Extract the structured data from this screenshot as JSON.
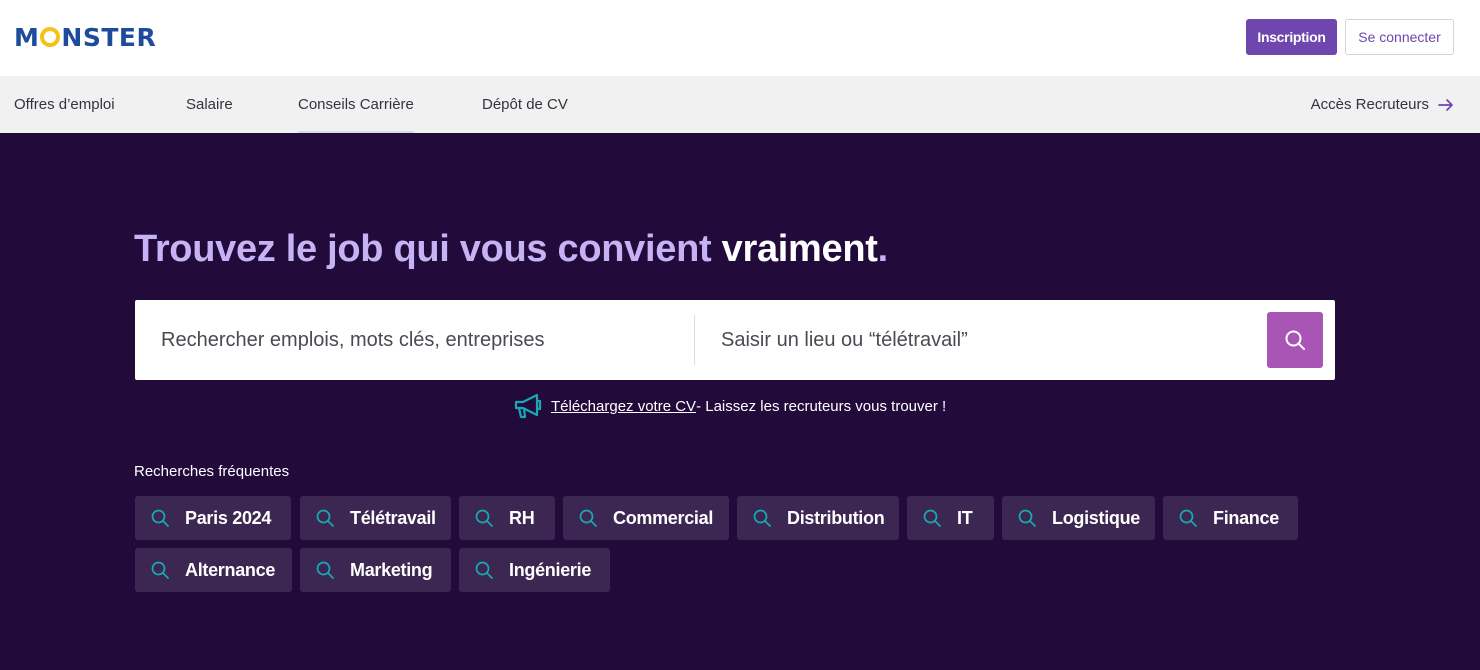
{
  "header": {
    "logo_before": "M",
    "logo_after": "NSTER",
    "signup_label": "Inscription",
    "login_label": "Se connecter"
  },
  "nav": {
    "items": [
      {
        "label": "Offres d’emploi"
      },
      {
        "label": "Salaire"
      },
      {
        "label": "Conseils Carrière"
      },
      {
        "label": "Dépôt de CV"
      }
    ],
    "recruiters_label": "Accès Recruteurs"
  },
  "hero": {
    "title_main": "Trouvez le job qui vous convient ",
    "title_accent": "vraiment",
    "title_end": "."
  },
  "search": {
    "keywords_placeholder": "Rechercher emplois, mots clés, entreprises",
    "location_placeholder": "Saisir un lieu ou “télétravail”"
  },
  "upload": {
    "link_label": "Téléchargez votre CV",
    "text": " - Laissez les recruteurs vous trouver !"
  },
  "frequent": {
    "label": "Recherches fréquentes",
    "chips": [
      {
        "label": "Paris 2024"
      },
      {
        "label": "Télétravail"
      },
      {
        "label": "RH"
      },
      {
        "label": "Commercial"
      },
      {
        "label": "Distribution"
      },
      {
        "label": "IT"
      },
      {
        "label": "Logistique"
      },
      {
        "label": "Finance"
      },
      {
        "label": "Alternance"
      },
      {
        "label": "Marketing"
      },
      {
        "label": "Ingénierie"
      }
    ]
  },
  "colors": {
    "brand_purple": "#6e46ae",
    "hero_background": "#220a3b",
    "hero_title": "#c5b3f4",
    "search_button": "#a855b5",
    "chip_background": "#3c2752",
    "accent_teal": "#17a9b3",
    "logo_blue": "#1e4c9a",
    "logo_yellow": "#f2c318"
  }
}
